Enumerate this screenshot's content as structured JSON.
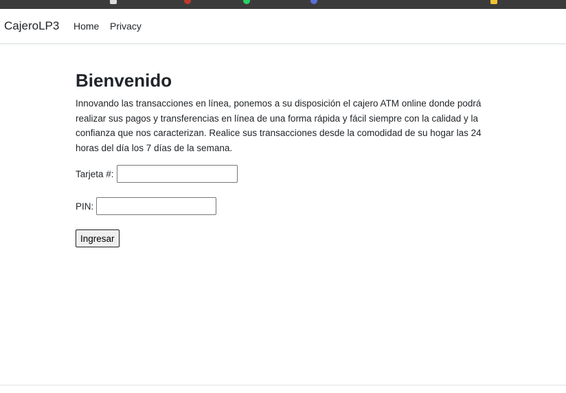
{
  "colors": {
    "browser_strip": "#3b3b3b",
    "text": "#212529",
    "border": "#dee2e6"
  },
  "navbar": {
    "brand": "CajeroLP3",
    "links": [
      "Home",
      "Privacy"
    ]
  },
  "main": {
    "title": "Bienvenido",
    "intro": "Innovando las transacciones en línea, ponemos a su disposición el cajero ATM online donde podrá realizar sus pagos y transferencias en línea de una forma rápida y fácil siempre con la calidad y la confianza que nos caracterizan. Realice sus transacciones desde la comodidad de su hogar las 24 horas del día los 7 días de la semana."
  },
  "form": {
    "card_label": "Tarjeta #:",
    "card_value": "",
    "pin_label": "PIN:",
    "pin_value": "",
    "submit_label": "Ingresar"
  }
}
